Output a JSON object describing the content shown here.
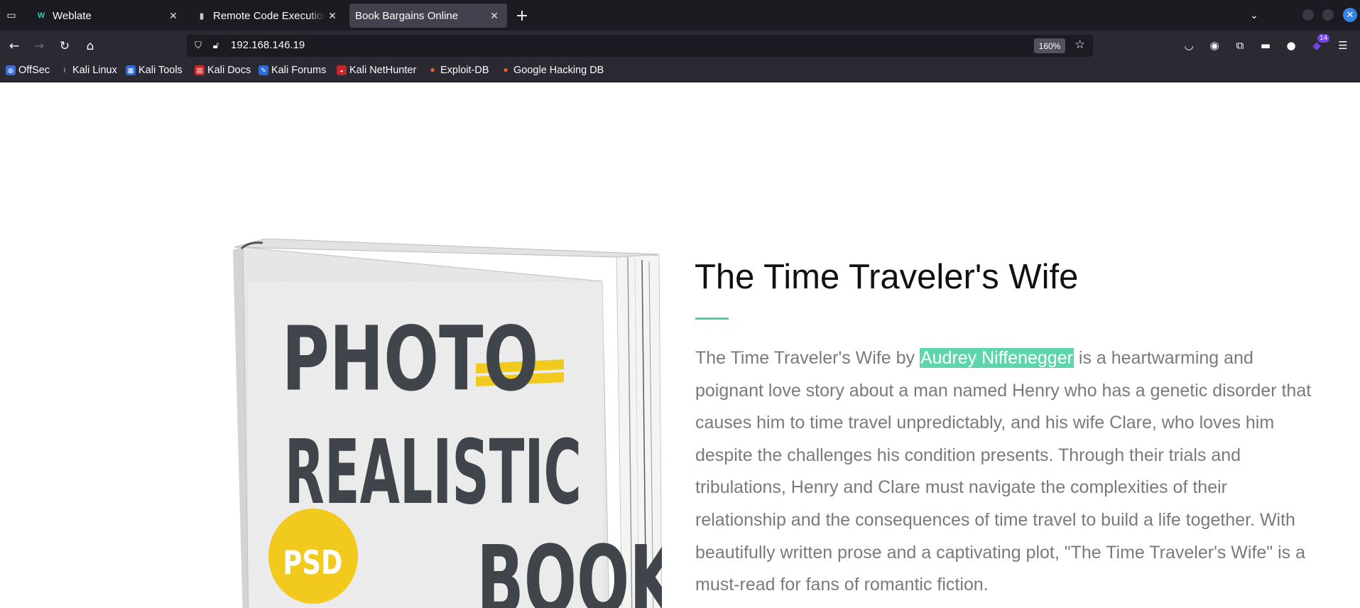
{
  "browser": {
    "tabs": [
      {
        "title": "Weblate",
        "favicon": "weblate-icon"
      },
      {
        "title": "Remote Code Execution (R",
        "favicon": "exploit-icon"
      },
      {
        "title": "Book Bargains Online",
        "favicon": "none",
        "active": true
      }
    ],
    "url": "192.168.146.19",
    "zoom": "160%",
    "extension_badge": "14",
    "bookmarks": [
      {
        "label": "OffSec",
        "icon": "offsec-icon"
      },
      {
        "label": "Kali Linux",
        "icon": "kali-dragon-icon"
      },
      {
        "label": "Kali Tools",
        "icon": "kali-tools-icon"
      },
      {
        "label": "Kali Docs",
        "icon": "kali-docs-icon"
      },
      {
        "label": "Kali Forums",
        "icon": "kali-forums-icon"
      },
      {
        "label": "Kali NetHunter",
        "icon": "nethunter-icon"
      },
      {
        "label": "Exploit-DB",
        "icon": "exploit-db-icon"
      },
      {
        "label": "Google Hacking DB",
        "icon": "ghdb-icon"
      }
    ]
  },
  "product": {
    "title": "The Time Traveler's Wife",
    "description_prefix": "The Time Traveler's Wife by ",
    "author": "Audrey Niffenegger",
    "description_suffix": " is a heartwarming and poignant love story about a man named Henry who has a genetic disorder that causes him to time travel unpredictably, and his wife Clare, who loves him despite the challenges his condition presents. Through their trials and tribulations, Henry and Clare must navigate the complexities of their relationship and the consequences of time travel to build a life together. With beautifully written prose and a captivating plot, \"The Time Traveler's Wife\" is a must-read for fans of romantic fiction.",
    "cover": {
      "line1": "PHOTO",
      "line2": "REALISTIC",
      "line3": "BOOK",
      "badge": "PSD"
    }
  },
  "colors": {
    "accent": "#4fd1a5",
    "highlight": "#5ed6ad",
    "body_text": "#7a7a7a",
    "cover_yellow": "#f2c91d",
    "cover_text": "#3f454a"
  }
}
